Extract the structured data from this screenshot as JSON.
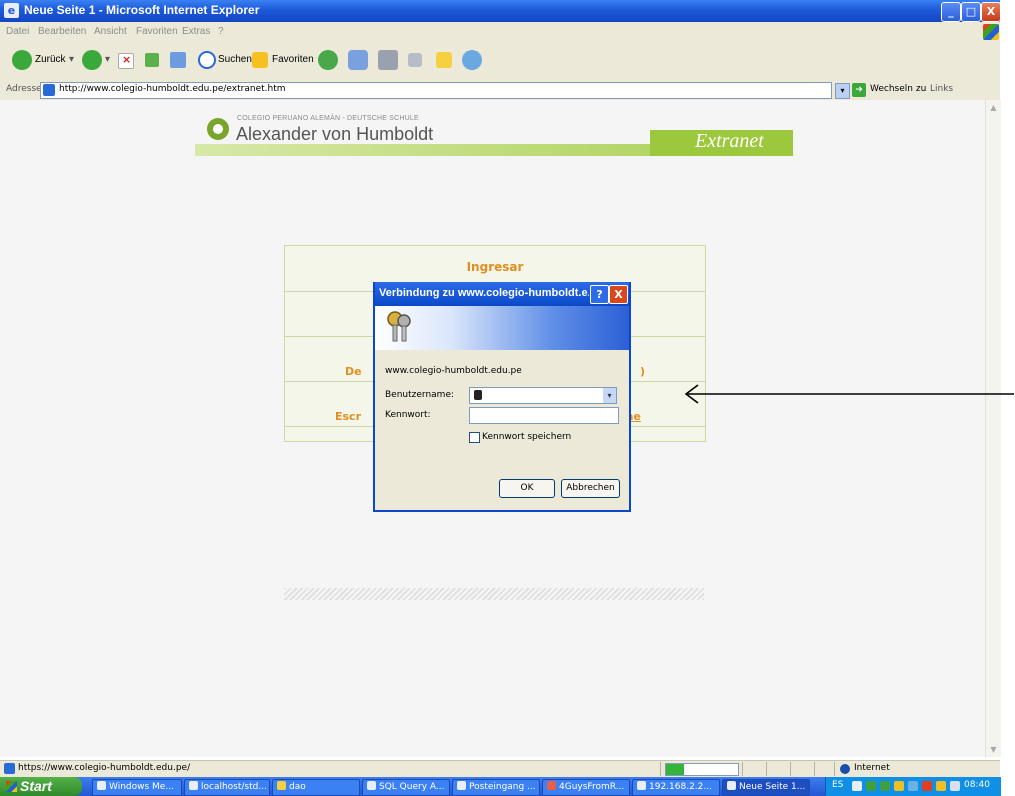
{
  "window": {
    "title": "Neue Seite 1 - Microsoft Internet Explorer",
    "controls": {
      "minimize": "_",
      "maximize": "□",
      "close": "X"
    }
  },
  "menu": [
    "Datei",
    "Bearbeiten",
    "Ansicht",
    "Favoriten",
    "Extras",
    "?"
  ],
  "toolbar": {
    "back_label": "Zurück",
    "search_label": "Suchen",
    "favorites_label": "Favoriten"
  },
  "address": {
    "label": "Adresse",
    "url": "http://www.colegio-humboldt.edu.pe/extranet.htm",
    "go_label": "Wechseln zu",
    "links_label": "Links"
  },
  "page": {
    "school_line": "COLEGIO PERUANO ALEMÁN - DEUTSCHE SCHULE",
    "school_name": "Alexander von Humboldt",
    "extranet": "Extranet",
    "login_title": "Ingresar",
    "row3_left": "De",
    "row3_right": ")",
    "row4_left": "Escr",
    "row4_right": "ae"
  },
  "dialog": {
    "title": "Verbindung zu www.colegio-humboldt.e...",
    "help": "?",
    "close": "X",
    "site": "www.colegio-humboldt.edu.pe",
    "username_label": "Benutzername:",
    "password_label": "Kennwort:",
    "remember_label": "Kennwort speichern",
    "remember_checked": false,
    "ok_label": "OK",
    "cancel_label": "Abbrechen"
  },
  "status": {
    "url": "https://www.colegio-humboldt.edu.pe/",
    "zone": "Internet",
    "progress": 0.25
  },
  "taskbar": {
    "start_label": "Start",
    "tasks": [
      "Windows Me...",
      "localhost/std...",
      "dao",
      "SQL Query A...",
      "Posteingang ...",
      "4GuysFromR...",
      "192.168.2.2...",
      "Neue Seite 1..."
    ],
    "active_task": 7,
    "language": "ES",
    "clock": "08:40"
  },
  "colors": {
    "xp_blue": "#1c5ad8",
    "school_green": "#9cc83e",
    "link_orange": "#e09020"
  }
}
